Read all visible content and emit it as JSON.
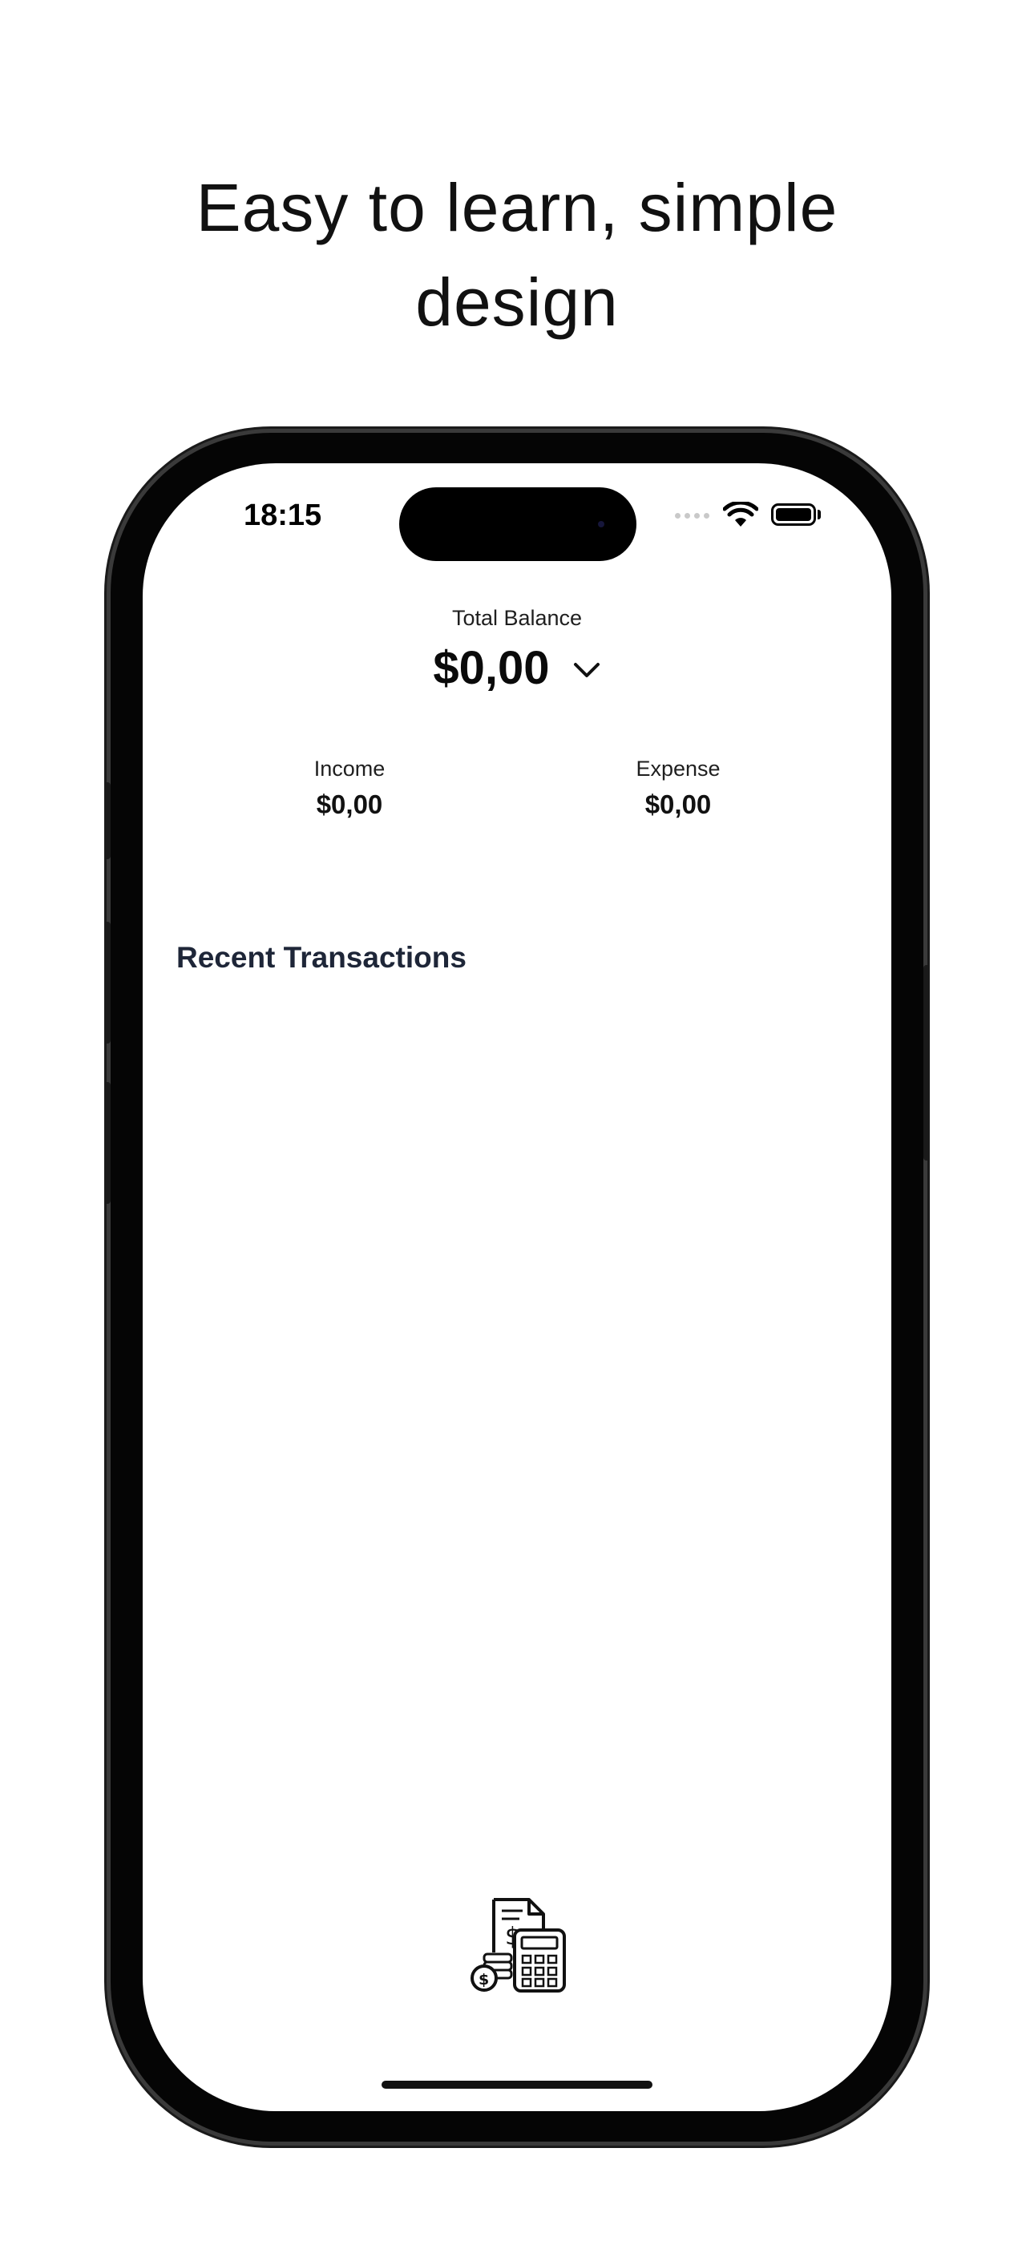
{
  "headline": {
    "line1": "Easy to learn, simple",
    "line2": "design"
  },
  "status_bar": {
    "time": "18:15",
    "wifi_icon": "wifi-icon",
    "battery_icon": "battery-icon"
  },
  "balance": {
    "label": "Total Balance",
    "value": "$0,00",
    "toggle_icon": "chevron-down-icon"
  },
  "income": {
    "label": "Income",
    "value": "$0,00"
  },
  "expense": {
    "label": "Expense",
    "value": "$0,00"
  },
  "transactions": {
    "title": "Recent Transactions",
    "items": [],
    "empty_icon": "receipt-calculator-icon"
  },
  "colors": {
    "background": "#ffffff",
    "text_primary": "#111111",
    "section_title": "#1e2638",
    "phone_frame": "#050505"
  }
}
